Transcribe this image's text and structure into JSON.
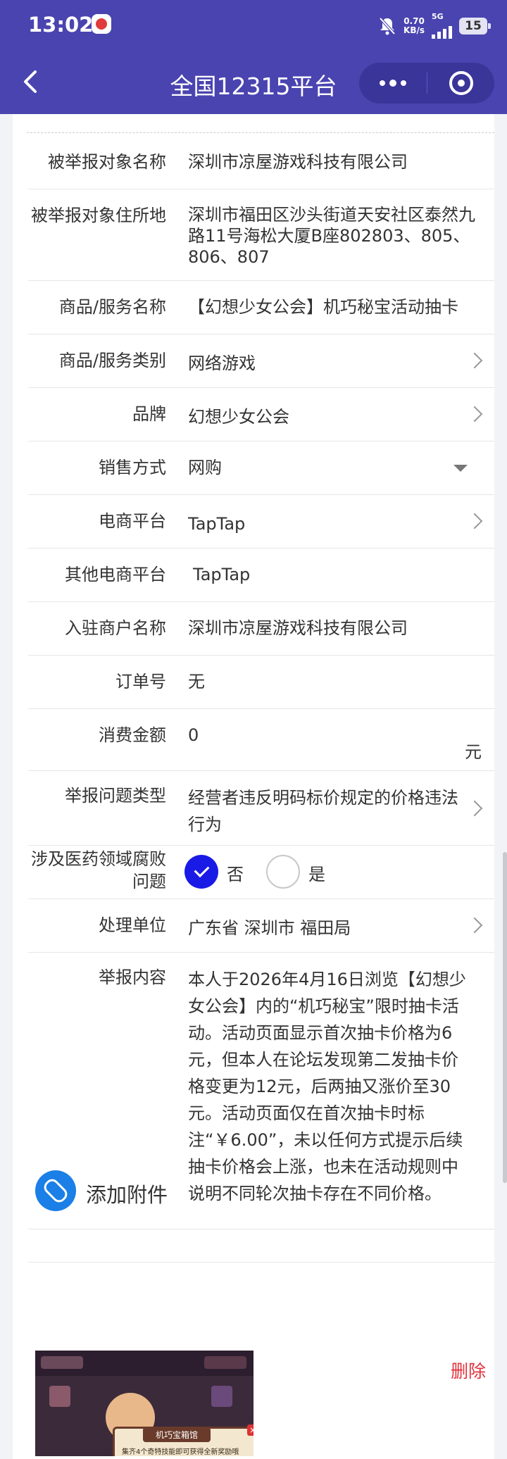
{
  "status": {
    "time": "13:02",
    "net_speed": "0.70",
    "net_unit": "KB/s",
    "network": "5G",
    "battery": "15"
  },
  "nav": {
    "title": "全国12315平台"
  },
  "form": {
    "rows": [
      {
        "label": "被举报对象名称",
        "value": "深圳市凉屋游戏科技有限公司"
      },
      {
        "label": "被举报对象住所地",
        "value": "深圳市福田区沙头街道天安社区泰然九路11号海松大厦B座802803、805、806、807"
      },
      {
        "label": "商品/服务名称",
        "value": "【幻想少女公会】机巧秘宝活动抽卡"
      },
      {
        "label": "商品/服务类别",
        "value": "网络游戏"
      },
      {
        "label": "品牌",
        "value": "幻想少女公会"
      },
      {
        "label": "销售方式",
        "value": "网购"
      },
      {
        "label": "电商平台",
        "value": "TapTap"
      },
      {
        "label": "其他电商平台",
        "value": "TapTap"
      },
      {
        "label": "入驻商户名称",
        "value": "深圳市凉屋游戏科技有限公司"
      },
      {
        "label": "订单号",
        "value": "无"
      },
      {
        "label": "消费金额",
        "value": "0",
        "unit": "元"
      },
      {
        "label": "举报问题类型",
        "value": "经营者违反明码标价规定的价格违法行为"
      },
      {
        "label": "涉及医药领域腐败问题",
        "options": [
          "否",
          "是"
        ],
        "selected": "否"
      },
      {
        "label": "处理单位",
        "value": "广东省 深圳市 福田局"
      },
      {
        "label": "举报内容",
        "value": "本人于2026年4月16日浏览【幻想少女公会】内的“机巧秘宝”限时抽卡活动。活动页面显示首次抽卡价格为6元，但本人在论坛发现第二发抽卡价格变更为12元，后两抽又涨价至30元。活动页面仅在首次抽卡时标注“￥6.00”，未以任何方式提示后续抽卡价格会上涨，也未在活动规则中说明不同轮次抽卡存在不同价格。"
      }
    ]
  },
  "attachments": {
    "add_label": "添加附件",
    "delete_label": "删除",
    "thumbnail": {
      "title": "机巧宝箱馆",
      "caption": "集齐4个奇特技能即可获得全新奖励哦"
    }
  },
  "colors": {
    "nav_bg": "#4a44b0",
    "accent_blue": "#1a1ae6",
    "delete_red": "#e0323c"
  }
}
